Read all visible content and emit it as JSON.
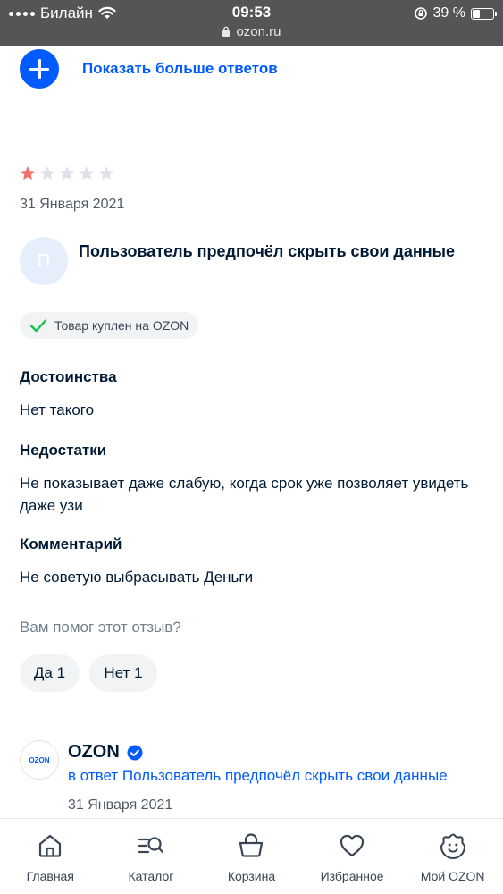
{
  "status_bar": {
    "carrier": "Билайн",
    "time": "09:53",
    "url": "ozon.ru",
    "battery_text": "39 %",
    "battery_level": 0.39
  },
  "show_more": {
    "label": "Показать больше ответов"
  },
  "review": {
    "rating": 1,
    "max_rating": 5,
    "date": "31 Января 2021",
    "avatar_letter": "П",
    "author": "Пользователь предпочёл скрыть свои данные",
    "purchase_badge": "Товар куплен на OZON",
    "sections": [
      {
        "title": "Достоинства",
        "text": "Нет такого"
      },
      {
        "title": "Недостатки",
        "text": "Не показывает даже слабую, когда срок уже позволяет увидеть даже узи"
      },
      {
        "title": "Комментарий",
        "text": "Не советую выбрасывать Деньги"
      }
    ],
    "helpful_question": "Вам помог этот отзыв?",
    "vote_yes": "Да 1",
    "vote_no": "Нет 1"
  },
  "seller_reply": {
    "logo_text": "OZON",
    "name": "OZON",
    "reply_to": "в ответ Пользователь предпочёл скрыть свои данные",
    "date": "31 Января 2021"
  },
  "bottom_nav": [
    {
      "label": "Главная",
      "icon": "home-icon"
    },
    {
      "label": "Каталог",
      "icon": "catalog-search-icon"
    },
    {
      "label": "Корзина",
      "icon": "basket-icon"
    },
    {
      "label": "Избранное",
      "icon": "heart-icon"
    },
    {
      "label": "Мой OZON",
      "icon": "profile-smile-icon"
    }
  ],
  "colors": {
    "accent": "#005bff",
    "star_filled": "#f1706a",
    "star_empty": "#dde2e8",
    "check": "#10c44c",
    "status_bar": "#555557"
  }
}
